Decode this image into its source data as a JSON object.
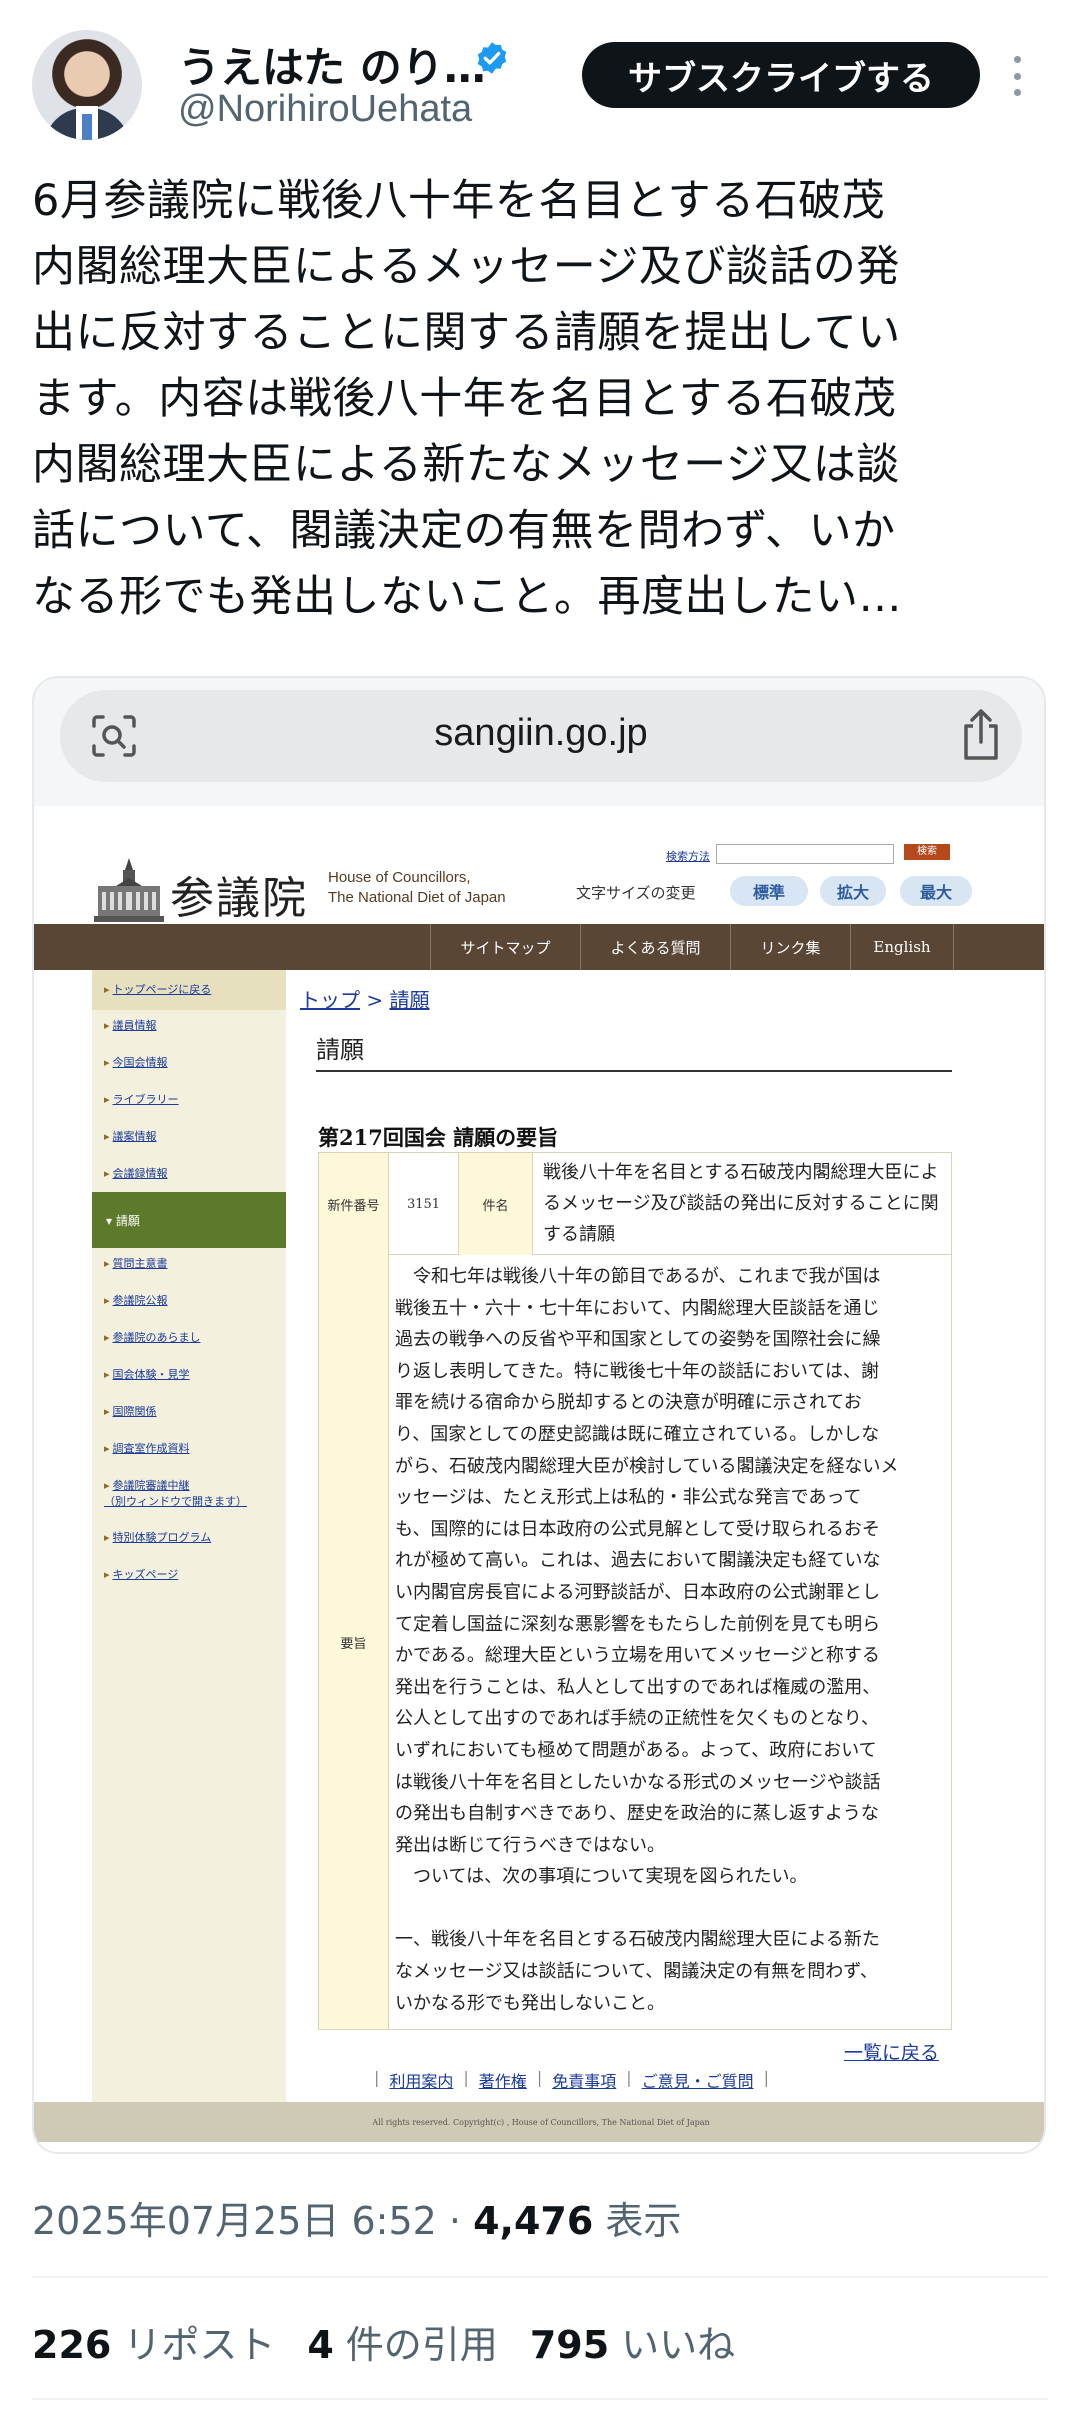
{
  "tweet": {
    "display_name": "うえはた のり…",
    "handle": "@NorihiroUehata",
    "subscribe_label": "サブスクライブする",
    "text": "6月参議院に戦後八十年を名目とする石破茂\n内閣総理大臣によるメッセージ及び談話の発\n出に反対することに関する請願を提出してい\nます。内容は戦後八十年を名目とする石破茂\n内閣総理大臣による新たなメッセージ又は談\n話について、閣議決定の有無を問わず、いか\nなる形でも発出しないこと。再度出したい…",
    "timestamp": "2025年07月25日 6:52 · ",
    "views_count": "4,476",
    "views_label": " 表示",
    "reposts_count": "226",
    "reposts_label": "リポスト",
    "quotes_count": "4",
    "quotes_label": "件の引用",
    "likes_count": "795",
    "likes_label": "いいね"
  },
  "browser": {
    "url": "sangiin.go.jp"
  },
  "site": {
    "logo_kanji": "参議院",
    "logo_en": "House of Councillors,\nThe National Diet of Japan",
    "search_link": "検索方法",
    "search_button": "検索",
    "font_size_label": "文字サイズの変更",
    "font_buttons": [
      "標準",
      "拡大",
      "最大"
    ],
    "nav": [
      "サイトマップ",
      "よくある質問",
      "リンク集",
      "English"
    ],
    "sidebar_top": "トップページに戻る",
    "sidebar_items": [
      "議員情報",
      "今国会情報",
      "ライブラリー",
      "議案情報",
      "会議録情報"
    ],
    "sidebar_active": "請願",
    "sidebar_items2": [
      "質問主意書",
      "参議院公報",
      "参議院のあらまし",
      "国会体験・見学",
      "国際関係",
      "調査室作成資料",
      "参議院審議中継\n（別ウィンドウで開きます）",
      "特別体験プログラム",
      "キッズページ"
    ],
    "breadcrumb_top": "トップ",
    "breadcrumb_sep": " > ",
    "breadcrumb_current": "請願",
    "page_heading": "請願",
    "session_title": "第217回国会 請願の要旨",
    "new_number_label": "新件番号",
    "new_number": "3151",
    "item_name_label": "件名",
    "petition_title": "戦後八十年を名目とする石破茂内閣総理大臣によるメッセージ及び談話の発出に反対することに関する請願",
    "summary_label": "要旨",
    "summary": "　令和七年は戦後八十年の節目であるが、これまで我が国は\n戦後五十・六十・七十年において、内閣総理大臣談話を通じ\n過去の戦争への反省や平和国家としての姿勢を国際社会に繰\nり返し表明してきた。特に戦後七十年の談話においては、謝\n罪を続ける宿命から脱却するとの決意が明確に示されてお\nり、国家としての歴史認識は既に確立されている。しかしな\nがら、石破茂内閣総理大臣が検討している閣議決定を経ないメ\nッセージは、たとえ形式上は私的・非公式な発言であって\nも、国際的には日本政府の公式見解として受け取られるおそ\nれが極めて高い。これは、過去において閣議決定も経ていな\nい内閣官房長官による河野談話が、日本政府の公式謝罪とし\nて定着し国益に深刻な悪影響をもたらした前例を見ても明ら\nかである。総理大臣という立場を用いてメッセージと称する\n発出を行うことは、私人として出すのであれば権威の濫用、\n公人として出すのであれば手続の正統性を欠くものとなり、\nいずれにおいても極めて問題がある。よって、政府において\nは戦後八十年を名目としたいかなる形式のメッセージや談話\nの発出も自制すべきであり、歴史を政治的に蒸し返すような\n発出は断じて行うべきではない。\n　ついては、次の事項について実現を図られたい。\n\n一、戦後八十年を名目とする石破茂内閣総理大臣による新た\nなメッセージ又は談話について、閣議決定の有無を問わず、\nいかなる形でも発出しないこと。",
    "back_link": "一覧に戻る",
    "footer_links": [
      "利用案内",
      "著作権",
      "免責事項",
      "ご意見・ご質問"
    ],
    "copyright": "All rights reserved. Copyright(c) , House of Councillors, The National Diet of Japan"
  }
}
